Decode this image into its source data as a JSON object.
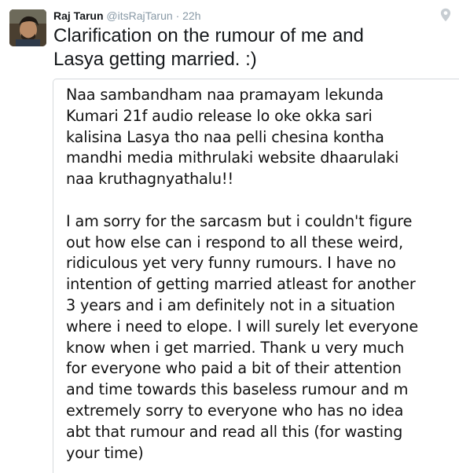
{
  "tweet": {
    "author_name": "Raj Tarun",
    "author_handle": "@itsRajTarun",
    "separator": "·",
    "timestamp": "22h",
    "text_line1": "Clarification on the rumour of me and",
    "text_line2": "Lasya getting married. :)"
  },
  "icons": {
    "avatar": "avatar",
    "location": "location-pin-icon"
  },
  "colors": {
    "name": "#14171a",
    "meta": "#8899a6",
    "card_border": "#d5d9dc"
  },
  "card": {
    "paragraph1": [
      "Naa sambandham naa pramayam lekunda",
      "Kumari 21f audio release lo oke okka sari",
      "kalisina Lasya tho naa pelli chesina kontha",
      "mandhi media mithrulaki website dhaarulaki",
      "naa kruthagnyathalu!!"
    ],
    "paragraph2": [
      "I am sorry for the sarcasm but i couldn't figure",
      "out how else can i respond to all these weird,",
      "ridiculous yet very funny rumours. I have no",
      "intention of getting married atleast for another",
      "3 years and i am definitely not in a situation",
      "where i need to elope. I will surely let everyone",
      "know when i get married. Thank u very much",
      "for everyone who paid a bit of their attention",
      "and time towards this baseless rumour and m",
      "extremely sorry to everyone who has no idea",
      "abt that rumour and read all this (for wasting",
      "your time)"
    ]
  }
}
